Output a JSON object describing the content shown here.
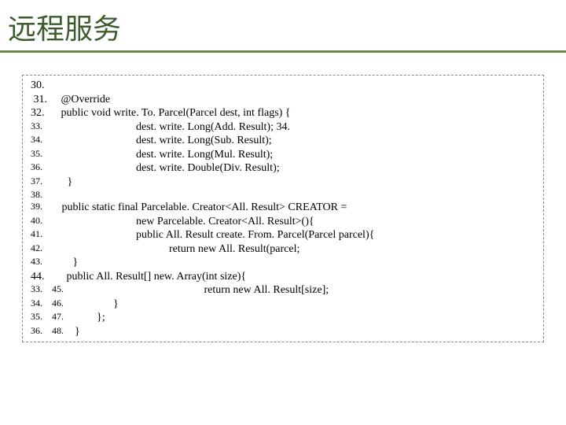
{
  "title": "远程服务",
  "code": {
    "lines": [
      {
        "ln": "30.",
        "ln2": "",
        "text": ""
      },
      {
        "ln": " 31.",
        "ln2": "",
        "text": "     @Override"
      },
      {
        "ln": "32.",
        "ln2": "",
        "text": "      public void write. To. Parcel(Parcel dest, int flags) {"
      },
      {
        "ln": "33.",
        "ln2": "",
        "text": "                                  dest. write. Long(Add. Result); 34.",
        "small": true
      },
      {
        "ln": "34.",
        "ln2": "",
        "text": "                                  dest. write. Long(Sub. Result);",
        "small": true
      },
      {
        "ln": "35.",
        "ln2": "",
        "text": "                                  dest. write. Long(Mul. Result);",
        "small": true
      },
      {
        "ln": "36.",
        "ln2": "",
        "text": "                                  dest. write. Double(Div. Result);",
        "small": true
      },
      {
        "ln": "37.",
        "ln2": "",
        "text": "         }",
        "small": true
      },
      {
        "ln": "38.",
        "ln2": "",
        "text": "",
        "small": true
      },
      {
        "ln": "39.",
        "ln2": "",
        "text": "       public static final Parcelable. Creator<All. Result> CREATOR =",
        "small": true
      },
      {
        "ln": "40.",
        "ln2": "",
        "text": "                                  new Parcelable. Creator<All. Result>(){",
        "small": true
      },
      {
        "ln": "41.",
        "ln2": "",
        "text": "                                  public All. Result create. From. Parcel(Parcel parcel){",
        "small": true
      },
      {
        "ln": "42.",
        "ln2": "",
        "text": "                                              return new All. Result(parcel;",
        "small": true
      },
      {
        "ln": "43.",
        "ln2": "",
        "text": "           }",
        "small": true
      },
      {
        "ln": "44.",
        "ln2": "",
        "text": "        public All. Result[] new. Array(int size){"
      },
      {
        "ln": "33.",
        "ln2": "45.",
        "text": "                                                   return new All. Result[size];",
        "small": true
      },
      {
        "ln": "34.",
        "ln2": "46.",
        "text": "                  }",
        "small": true
      },
      {
        "ln": "35.",
        "ln2": "47.",
        "text": "            };",
        "small": true
      },
      {
        "ln": "36.",
        "ln2": "48.",
        "text": "    }",
        "small": true
      }
    ]
  }
}
